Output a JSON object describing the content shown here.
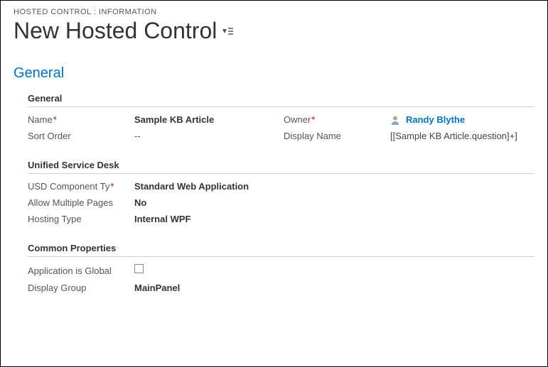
{
  "breadcrumb": "HOSTED CONTROL : INFORMATION",
  "page_title": "New Hosted Control",
  "section_title": "General",
  "subsections": {
    "general": {
      "title": "General",
      "fields": {
        "name": {
          "label": "Name",
          "value": "Sample KB Article"
        },
        "owner": {
          "label": "Owner",
          "value": "Randy Blythe"
        },
        "sort_order": {
          "label": "Sort Order",
          "value": "--"
        },
        "display_name": {
          "label": "Display Name",
          "value": "[[Sample KB Article.question]+]"
        }
      }
    },
    "usd": {
      "title": "Unified Service Desk",
      "fields": {
        "component_type": {
          "label": "USD Component Ty",
          "value": "Standard Web Application"
        },
        "allow_multiple": {
          "label": "Allow Multiple Pages",
          "value": "No"
        },
        "hosting_type": {
          "label": "Hosting Type",
          "value": "Internal WPF"
        }
      }
    },
    "common": {
      "title": "Common Properties",
      "fields": {
        "app_global": {
          "label": "Application is Global"
        },
        "display_group": {
          "label": "Display Group",
          "value": "MainPanel"
        }
      }
    }
  }
}
